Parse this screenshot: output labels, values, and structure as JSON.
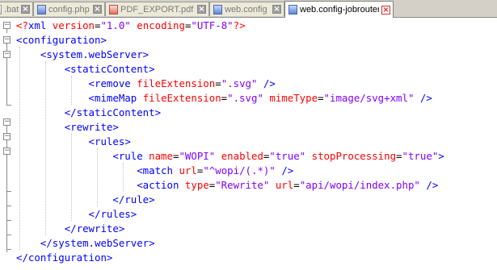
{
  "tabs": [
    {
      "label": ".bat",
      "icon": "file-icon",
      "active": false
    },
    {
      "label": "config.php",
      "icon": "file-icon",
      "active": false
    },
    {
      "label": "PDF_EXPORT.pdf",
      "icon": "pdf-file-icon",
      "active": false
    },
    {
      "label": "web.config",
      "icon": "file-icon",
      "active": false
    },
    {
      "label": "web.config-jobrouter",
      "icon": "file-icon",
      "active": true
    }
  ],
  "close_glyph": "×",
  "editor": {
    "line1": {
      "open": "<?",
      "tag": "xml",
      "a1": "version",
      "v1": "\"1.0\"",
      "a2": "encoding",
      "v2": "\"UTF-8\"",
      "close": "?>"
    },
    "line2": {
      "tag": "configuration"
    },
    "line3": {
      "tag": "system.webServer"
    },
    "line4": {
      "tag": "staticContent"
    },
    "line5": {
      "tag": "remove",
      "a1": "fileExtension",
      "v1": "\".svg\""
    },
    "line6": {
      "tag": "mimeMap",
      "a1": "fileExtension",
      "v1": "\".svg\"",
      "a2": "mimeType",
      "v2": "\"image/svg+xml\""
    },
    "line7": {
      "tag": "staticContent"
    },
    "line8": {
      "tag": "rewrite"
    },
    "line9": {
      "tag": "rules"
    },
    "line10": {
      "tag": "rule",
      "a1": "name",
      "v1": "\"WOPI\"",
      "a2": "enabled",
      "v2": "\"true\"",
      "a3": "stopProcessing",
      "v3": "\"true\""
    },
    "line11": {
      "tag": "match",
      "a1": "url",
      "v1": "\"^wopi/(.*)\""
    },
    "line12": {
      "tag": "action",
      "a1": "type",
      "v1": "\"Rewrite\"",
      "a2": "url",
      "v2": "\"api/wopi/index.php\""
    },
    "line13": {
      "tag": "rule"
    },
    "line14": {
      "tag": "rules"
    },
    "line15": {
      "tag": "rewrite"
    },
    "line16": {
      "tag": "system.webServer"
    },
    "line17": {
      "tag": "configuration"
    }
  },
  "colors": {
    "tag": "#0000ff",
    "attribute": "#ff0000",
    "value": "#8000ff"
  }
}
